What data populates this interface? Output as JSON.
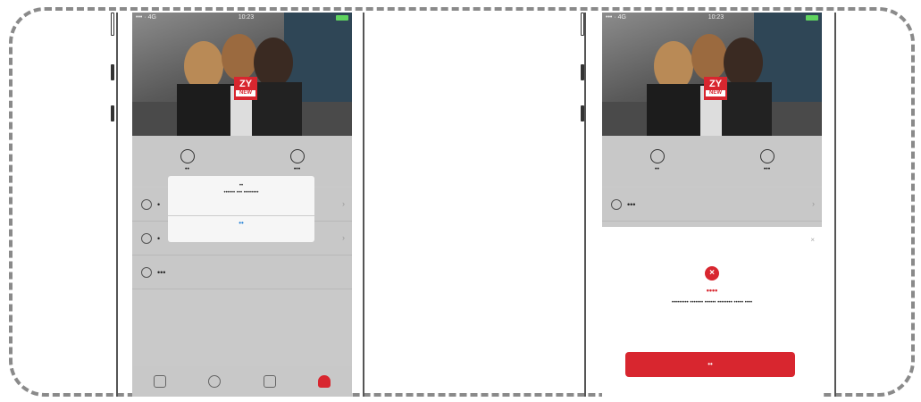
{
  "left_screen": {
    "status_left": "••• · 4G",
    "status_center": "10:23",
    "logo_text": "ZY",
    "logo_sub": "NEW",
    "quick_actions": [
      {
        "label": "••",
        "icon": "tripod-icon"
      },
      {
        "label": "•••",
        "icon": "refresh-icon"
      }
    ],
    "menu_items": [
      {
        "label": "•",
        "icon": "circle-icon"
      },
      {
        "label": "•",
        "icon": "gear-icon"
      },
      {
        "label": "•••",
        "icon": "settings-icon"
      }
    ],
    "dialog": {
      "title": "••",
      "message": "•••••• ••• ••••••••",
      "ok_label": "••"
    },
    "tabs": [
      "home-icon",
      "camera-icon",
      "folder-icon",
      "user-icon"
    ]
  },
  "right_screen": {
    "status_left": "••• · 4G",
    "status_center": "10:23",
    "logo_text": "ZY",
    "logo_sub": "NEW",
    "quick_actions": [
      {
        "label": "••",
        "icon": "tripod-icon"
      },
      {
        "label": "•••",
        "icon": "refresh-icon"
      }
    ],
    "menu_items": [
      {
        "label": "•••",
        "icon": "circle-icon"
      }
    ],
    "sheet": {
      "close": "×",
      "error_symbol": "×",
      "error_title": "••••",
      "error_body": "••••••••• ••••••• •••••• •••••••• ••••• ••••",
      "button_label": "••"
    }
  },
  "colors": {
    "accent": "#d8262f",
    "link": "#1e7ed4",
    "panel": "#c8c8c8"
  }
}
